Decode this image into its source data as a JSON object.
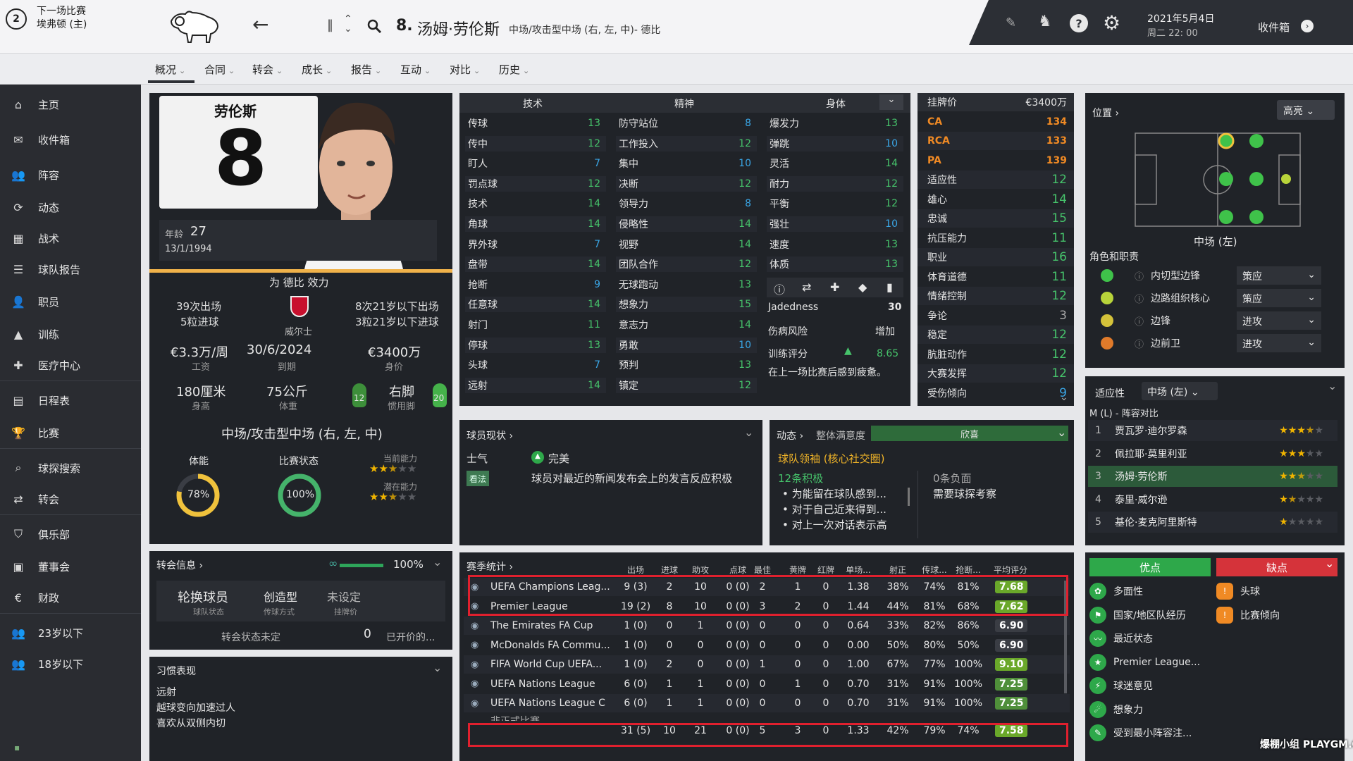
{
  "topbar": {
    "next_match_label": "下一场比赛",
    "next_match_opponent": "埃弗顿 (主)",
    "next_match_number": "2",
    "player_number": "8.",
    "player_name": "汤姆·劳伦斯",
    "player_position": "中场/攻击型中场 (右, 左, 中)- 德比",
    "date": "2021年5月4日",
    "time": "周二 22: 00",
    "inbox": "收件箱"
  },
  "subnav": [
    "概况",
    "合同",
    "转会",
    "成长",
    "报告",
    "互动",
    "对比",
    "历史"
  ],
  "sidebar": [
    "主页",
    "收件箱",
    "阵容",
    "动态",
    "战术",
    "球队报告",
    "职员",
    "训练",
    "医疗中心",
    "日程表",
    "比赛",
    "球探搜索",
    "转会",
    "俱乐部",
    "董事会",
    "财政",
    "23岁以下",
    "18岁以下"
  ],
  "profile": {
    "shirt_name": "劳伦斯",
    "shirt_number": "8",
    "age_label": "年龄",
    "age": "27",
    "dob": "13/1/1994",
    "plays_for": "为 德比 效力",
    "apps": "39次出场",
    "goals": "5粒进球",
    "nation": "威尔士",
    "u21_apps": "8次21岁以下出场",
    "u21_goals": "3粒21岁以下进球",
    "wage": "€3.3万/周",
    "wage_label": "工资",
    "expires": "30/6/2024",
    "expires_label": "到期",
    "value": "€3400万",
    "value_label": "身价",
    "height": "180厘米",
    "height_label": "身高",
    "weight": "75公斤",
    "weight_label": "体重",
    "foot": "右脚",
    "foot_label": "惯用脚",
    "left_foot": "12",
    "right_foot": "20",
    "position": "中场/攻击型中场 (右, 左, 中)",
    "fitness_label": "体能",
    "fitness": "78%",
    "fitness_value": 0.78,
    "form_label": "比赛状态",
    "form": "100%",
    "form_value": 1.0,
    "current_ability_label": "当前能力",
    "potential_ability_label": "潜在能力",
    "current_stars": 2.5,
    "potential_stars": 2.5
  },
  "attributes": {
    "headers": [
      "技术",
      "精神",
      "身体"
    ],
    "technical": [
      [
        "传球",
        "13"
      ],
      [
        "传中",
        "12"
      ],
      [
        "盯人",
        "7"
      ],
      [
        "罚点球",
        "12"
      ],
      [
        "技术",
        "14"
      ],
      [
        "角球",
        "14"
      ],
      [
        "界外球",
        "7"
      ],
      [
        "盘带",
        "14"
      ],
      [
        "抢断",
        "9"
      ],
      [
        "任意球",
        "14"
      ],
      [
        "射门",
        "11"
      ],
      [
        "停球",
        "13"
      ],
      [
        "头球",
        "7"
      ],
      [
        "远射",
        "14"
      ]
    ],
    "mental": [
      [
        "防守站位",
        "8"
      ],
      [
        "工作投入",
        "12"
      ],
      [
        "集中",
        "10"
      ],
      [
        "决断",
        "12"
      ],
      [
        "领导力",
        "8"
      ],
      [
        "侵略性",
        "14"
      ],
      [
        "视野",
        "14"
      ],
      [
        "团队合作",
        "12"
      ],
      [
        "无球跑动",
        "13"
      ],
      [
        "想象力",
        "15"
      ],
      [
        "意志力",
        "14"
      ],
      [
        "勇敢",
        "10"
      ],
      [
        "预判",
        "13"
      ],
      [
        "镇定",
        "12"
      ]
    ],
    "physical": [
      [
        "爆发力",
        "13"
      ],
      [
        "弹跳",
        "10"
      ],
      [
        "灵活",
        "14"
      ],
      [
        "耐力",
        "12"
      ],
      [
        "平衡",
        "12"
      ],
      [
        "强壮",
        "10"
      ],
      [
        "速度",
        "13"
      ],
      [
        "体质",
        "13"
      ]
    ],
    "jadedness_label": "Jadedness",
    "jadedness": "30",
    "injury_label": "伤病风险",
    "injury": "增加",
    "training_label": "训练评分",
    "training": "8.65",
    "training_note": "在上一场比赛后感到疲惫。"
  },
  "hidden": [
    [
      "挂牌价",
      "€3400万"
    ],
    [
      "CA",
      "134"
    ],
    [
      "RCA",
      "133"
    ],
    [
      "PA",
      "139"
    ],
    [
      "适应性",
      "12"
    ],
    [
      "雄心",
      "14"
    ],
    [
      "忠诚",
      "15"
    ],
    [
      "抗压能力",
      "11"
    ],
    [
      "职业",
      "16"
    ],
    [
      "体育道德",
      "11"
    ],
    [
      "情绪控制",
      "12"
    ],
    [
      "争论",
      "3"
    ],
    [
      "稳定",
      "12"
    ],
    [
      "肮脏动作",
      "12"
    ],
    [
      "大赛发挥",
      "12"
    ],
    [
      "受伤倾向",
      "9"
    ]
  ],
  "position_panel": {
    "title": "位置 ›",
    "highlight": "高亮",
    "pos_label": "中场 (左)",
    "roles_title": "角色和职责",
    "roles": [
      [
        "内切型边锋",
        "策应"
      ],
      [
        "边路组织核心",
        "策应"
      ],
      [
        "边锋",
        "进攻"
      ],
      [
        "边前卫",
        "进攻"
      ]
    ]
  },
  "suitability": {
    "label": "适应性",
    "value": "中场 (左)",
    "compare": "M (L) - 阵容对比",
    "list": [
      [
        "1",
        "贾瓦罗·迪尔罗森",
        3.5
      ],
      [
        "2",
        "佩拉耶·莫里利亚",
        3
      ],
      [
        "3",
        "汤姆·劳伦斯",
        2.5
      ],
      [
        "4",
        "泰里·威尔逊",
        1.5
      ],
      [
        "5",
        "基伦·麦克阿里斯特",
        1
      ]
    ]
  },
  "strengths": {
    "pros_label": "优点",
    "cons_label": "缺点",
    "pros": [
      "多面性",
      "国家/地区队经历",
      "最近状态",
      "Premier League...",
      "球迷意见",
      "想象力",
      "受到最小阵容注..."
    ],
    "cons": [
      "头球",
      "比赛倾向"
    ]
  },
  "status": {
    "title": "球员现状 ›",
    "morale_label": "士气",
    "morale": "完美",
    "view": "看法",
    "note": "球员对最近的新闻发布会上的发言反应积极"
  },
  "dynamics": {
    "title": "动态 ›",
    "satisfaction_label": "整体满意度",
    "satisfaction": "欣喜",
    "leader": "球队领袖 (核心社交圈)",
    "positives": "12条积极",
    "negatives": "0条负面",
    "scout": "需要球探考察",
    "items": [
      "为能留在球队感到...",
      "对于自己近来得到...",
      "对上一次对话表示高"
    ]
  },
  "transfer": {
    "title": "转会信息 ›",
    "pct": "100%",
    "status": "轮换球员",
    "status_label": "球队状态",
    "style": "创造型",
    "style_label": "传球方式",
    "price": "未设定",
    "price_label": "挂牌价",
    "footer": "转会状态未定",
    "offers": "0",
    "offers_label": "已开价的..."
  },
  "habits": {
    "title": "习惯表现",
    "items": [
      "远射",
      "越球变向加速过人",
      "喜欢从双侧内切"
    ]
  },
  "season": {
    "title": "赛季统计 ›",
    "headers": [
      "出场",
      "进球",
      "助攻",
      "点球",
      "最佳",
      "黄牌",
      "红牌",
      "单场...",
      "射正",
      "传球...",
      "抢断...",
      "平均评分"
    ],
    "rows": [
      [
        "UEFA Champions Leag...",
        "9 (3)",
        "2",
        "10",
        "0 (0)",
        "2",
        "1",
        "0",
        "1.38",
        "38%",
        "74%",
        "81%",
        "7.68"
      ],
      [
        "Premier League",
        "19 (2)",
        "8",
        "10",
        "0 (0)",
        "3",
        "2",
        "0",
        "1.44",
        "44%",
        "81%",
        "68%",
        "7.62"
      ],
      [
        "The Emirates FA Cup",
        "1 (0)",
        "0",
        "1",
        "0 (0)",
        "0",
        "0",
        "0",
        "0.64",
        "33%",
        "82%",
        "86%",
        "6.90"
      ],
      [
        "McDonalds FA Commu...",
        "1 (0)",
        "0",
        "0",
        "0 (0)",
        "0",
        "0",
        "0",
        "0.00",
        "50%",
        "80%",
        "50%",
        "6.90"
      ],
      [
        "FIFA World Cup UEFA...",
        "1 (0)",
        "2",
        "0",
        "0 (0)",
        "1",
        "0",
        "0",
        "1.00",
        "67%",
        "77%",
        "100%",
        "9.10"
      ],
      [
        "UEFA Nations League",
        "6 (0)",
        "1",
        "1",
        "0 (0)",
        "0",
        "1",
        "0",
        "0.70",
        "31%",
        "91%",
        "100%",
        "7.25"
      ],
      [
        "UEFA Nations League C",
        "6 (0)",
        "1",
        "1",
        "0 (0)",
        "0",
        "0",
        "0",
        "0.70",
        "31%",
        "91%",
        "100%",
        "7.25"
      ]
    ],
    "partial_row": "非正式比赛",
    "total": [
      "31 (5)",
      "10",
      "21",
      "0 (0)",
      "5",
      "3",
      "0",
      "1.33",
      "42%",
      "79%",
      "74%",
      "7.58"
    ]
  },
  "watermark": "爆棚小组 PLAYGM.CC"
}
